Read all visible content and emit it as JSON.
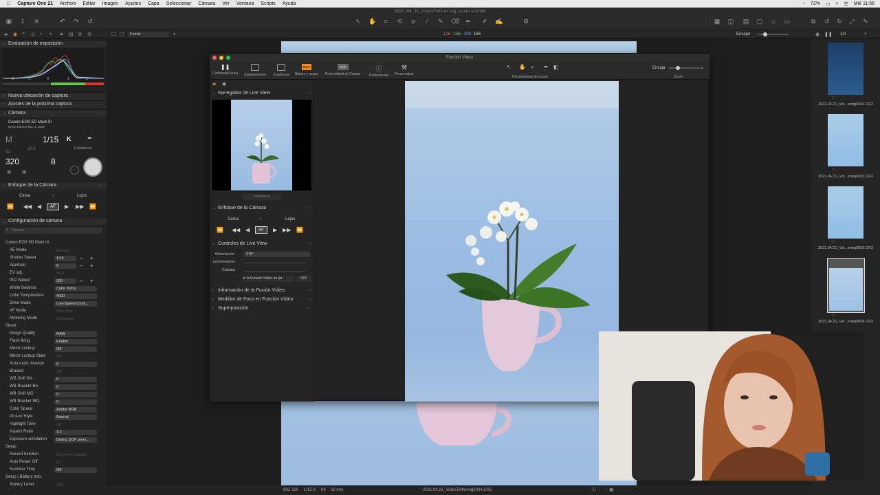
{
  "menubar": {
    "app": "Capture One 21",
    "items": [
      "Archivo",
      "Editar",
      "Imagen",
      "Ajustes",
      "Capa",
      "Seleccionar",
      "Cámara",
      "Ver",
      "Ventana",
      "Scripts",
      "Ayuda"
    ],
    "battery": "72%",
    "clock": "Mié 11:56"
  },
  "window_title": "2021.04.21_VideoTethering.cosessiondb",
  "toolbar": {
    "readout": {
      "r": "126",
      "g": "166",
      "b": "200",
      "a": "158"
    },
    "fit_label": "Encajar",
    "counter": "1/4",
    "layer": "Fondo"
  },
  "left": {
    "exposure_title": "Evaluación de exposición",
    "hist_ticks": [
      "-2",
      "-1",
      "0",
      "1",
      "2"
    ],
    "new_capture": "Nueva ubicación de captura",
    "next_capture": "Ajustes de la próxima captura",
    "camera_title": "Cámara",
    "camera_model": "Canon EOS 5D Mark III",
    "lens": "EF24-105mm f/4L IS USM",
    "mode": "M",
    "shutter": "1/15",
    "ev": "±0.0",
    "iso": "320",
    "aperture": "8",
    "wb_k": "K",
    "set_label": "Establecer",
    "focus_title": "Enfoque de la Cámara",
    "near": "Cerca",
    "far": "Lejos",
    "af": "AF",
    "config_title": "Configuración de cámara",
    "search_placeholder": "Buscar",
    "group_camera": "Canon EOS 5D Mark III",
    "settings": [
      {
        "label": "AE Mode",
        "value": "Manual",
        "dim": true
      },
      {
        "label": "Shutter Speed",
        "value": "1/15",
        "pm": true
      },
      {
        "label": "Aperture",
        "value": "8",
        "pm": true
      },
      {
        "label": "EV adj.",
        "value": "±0.0",
        "dim": true
      },
      {
        "label": "ISO Speed",
        "value": "320",
        "pm": true
      },
      {
        "label": "White Balance",
        "value": "Color Temp."
      },
      {
        "label": "Color Temperature",
        "value": "4000"
      },
      {
        "label": "Drive Mode",
        "value": "Low-Speed Conti..."
      },
      {
        "label": "AF Mode",
        "value": "One-Shot",
        "dim": true
      },
      {
        "label": "Metering Mode",
        "value": "Evaluative",
        "dim": true
      }
    ],
    "group_shoot": "Shoot",
    "shoot": [
      {
        "label": "Image Quality",
        "value": "RAW"
      },
      {
        "label": "Flash firing",
        "value": "Enable"
      },
      {
        "label": "Mirror Lockup",
        "value": "Off"
      },
      {
        "label": "Mirror Lockup State",
        "value": "Off",
        "dim": true
      },
      {
        "label": "Auto expo. bracket",
        "value": "0"
      },
      {
        "label": "Bracket",
        "value": "Off",
        "dim": true
      },
      {
        "label": "WB Shift BA",
        "value": "0"
      },
      {
        "label": "WB Bracket BA",
        "value": "0"
      },
      {
        "label": "WB Shift MG",
        "value": "0"
      },
      {
        "label": "WB Bracket MG",
        "value": "0"
      },
      {
        "label": "Color Space",
        "value": "Adobe RGB"
      },
      {
        "label": "Picture Style",
        "value": "Neutral"
      },
      {
        "label": "Highlight Tone",
        "value": "Off",
        "dim": true
      },
      {
        "label": "Aspect Ratio",
        "value": "3:2"
      },
      {
        "label": "Exposure simulation",
        "value": "During DOF previ..."
      }
    ],
    "group_setup": "Setup",
    "setup": [
      {
        "label": "Record function",
        "value": "Record to multiple",
        "dim": true
      },
      {
        "label": "Auto Power Off",
        "value": "60",
        "dim": true
      },
      {
        "label": "Summer Time",
        "value": "Off"
      }
    ],
    "group_battery": "Setup | Battery Info.",
    "battery": [
      {
        "label": "Battery Level",
        "value": "100",
        "dim": true
      }
    ]
  },
  "liveview": {
    "title": "Función Vídeo",
    "tools": [
      "Continuar/Pausa",
      "Superposición",
      "Cuadrícula",
      "Blanco y negro",
      "Profundidad de Campo",
      "Preferencias",
      "Personalizar"
    ],
    "bw_badge": "B&W",
    "dof_badge": "DOF",
    "cursor_tools": "Herramientas de cursor",
    "fit": "Encaja",
    "zoom": "Zoom",
    "navigator": "Navegador de Live View",
    "refresh": "Refrescar",
    "focus": "Enfoque de la Cámara",
    "near": "Cerca",
    "far": "Lejos",
    "af": "AF",
    "controls": "Controles de Live View",
    "orientation_label": "Orientación",
    "orientation_value": "270°",
    "brightness_label": "Luminosidad",
    "quality_label": "Calidad",
    "video_btn": "er la Función Vídeo en pa",
    "dof_btn": "DOF",
    "info": "Información de la Fución Vídeo",
    "meter": "Medidor de Foco en Función Vídeo",
    "overlay": "Superposición"
  },
  "thumbs": [
    "2021.04.21_Vid...ering0001.CR2",
    "2021.04.21_Vid...ering0002.CR2",
    "2021.04.21_Vid...ering0003.CR2",
    "2021.04.21_Vid...ering0004.CR2"
  ],
  "status": {
    "iso": "ISO 320",
    "shutter": "1/15 S",
    "aperture": "f/8",
    "focal": "32 mm",
    "file": "2021.04.21_VideoTethering0004.CR2"
  }
}
